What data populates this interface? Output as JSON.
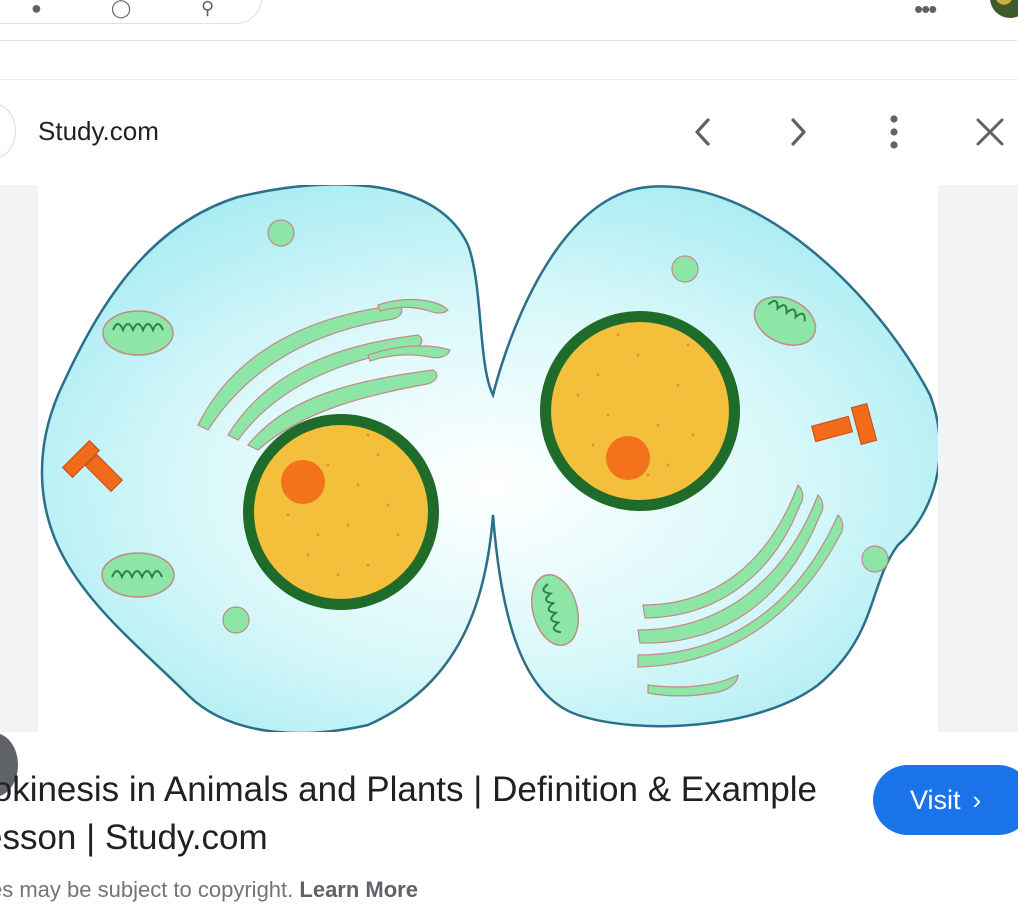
{
  "header": {
    "search_icons": [
      "mic-icon",
      "lens-icon",
      "search-icon"
    ],
    "apps_icon": "apps-dots-icon",
    "avatar": "user-avatar"
  },
  "preview": {
    "source": "Study.com",
    "buttons": {
      "previous": "chevron-left-icon",
      "next": "chevron-right-icon",
      "more": "more-vert-icon",
      "close": "close-icon"
    },
    "image": {
      "subject": "animal cell cytokinesis illustration",
      "colors": {
        "cytoplasm": "#b6f0f5",
        "membrane": "#2b6f8a",
        "nucleus": "#f4c03b",
        "nuclear_envelope": "#1e6b2a",
        "organelle": "#8ee6a6",
        "centriole": "#f26a1b"
      }
    },
    "title_line1": "tokinesis in Animals and Plants | Definition & Example",
    "title_line2": "esson | Study.com",
    "visit_label": "Visit",
    "copyright_text": "es may be subject to copyright.",
    "learn_more": "Learn More"
  },
  "colors": {
    "accent": "#1a73e8",
    "text": "#202124",
    "muted": "#70757a"
  }
}
